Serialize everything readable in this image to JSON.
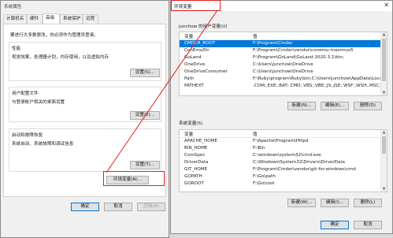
{
  "left_dialog": {
    "title": "系统属性",
    "tabs": [
      {
        "label": "计算机名"
      },
      {
        "label": "硬件"
      },
      {
        "label": "高级"
      },
      {
        "label": "系统保护"
      },
      {
        "label": "远程"
      }
    ],
    "admin_note": "要进行大多数更改，你必须作为管理员登录。",
    "performance": {
      "heading": "性能",
      "desc": "视觉效果，处理器计划，内存使用，以及虚拟内存",
      "button": "设置(S)..."
    },
    "profiles": {
      "heading": "用户配置文件",
      "desc": "与登录帐户相关的桌面设置",
      "button": "设置(E)..."
    },
    "startup": {
      "heading": "启动和故障恢复",
      "desc": "系统启动、系统故障和调试信息",
      "button": "设置(T)..."
    },
    "env_button": "环境变量(N)...",
    "ok": "确定",
    "cancel": "取消",
    "apply": "应用(A)"
  },
  "env_dialog": {
    "title": "环境变量",
    "close_glyph": "✕",
    "user_section_label": "junchow 的用户变量(U)",
    "columns": {
      "var": "变量",
      "val": "值"
    },
    "user_vars": [
      {
        "name": "CMDER_ROOT",
        "value": "F:\\Program\\Cmder",
        "selected": true
      },
      {
        "name": "ConEmuDir",
        "value": "F:\\Program\\Cmder\\vendor\\conemu-maximus5",
        "selected": false
      },
      {
        "name": "GoLand",
        "value": "F:\\Program\\GoLand\\GoLand 2020.3.1\\bin;",
        "selected": false
      },
      {
        "name": "OneDrive",
        "value": "C:\\Users\\junchow\\OneDrive",
        "selected": false
      },
      {
        "name": "OneDriveConsumer",
        "value": "C:\\Users\\junchow\\OneDrive",
        "selected": false
      },
      {
        "name": "Path",
        "value": "F:\\Ruby\\program\\Ruby\\bin;C:\\Users\\junchow\\AppData\\Local\\...",
        "selected": false
      },
      {
        "name": "PATHEXT",
        "value": ".COM;.EXE;.BAT;.CMD;.VBS;.VBE;.JS;.JSE;.WSF;.WSH;.MSC;.RB;...",
        "selected": false
      }
    ],
    "user_buttons": {
      "new": "新建(N)...",
      "edit": "编辑(E)...",
      "delete": "删除(D)"
    },
    "system_section_label": "系统变量(S)",
    "system_vars": [
      {
        "name": "APACHE_HOME",
        "value": "F:\\Apache\\Program\\Httpd"
      },
      {
        "name": "BIN_HOME",
        "value": "F:\\Bin"
      },
      {
        "name": "ComSpec",
        "value": "C:\\windows\\system32\\cmd.exe"
      },
      {
        "name": "DriverData",
        "value": "C:\\Windows\\System32\\Drivers\\DriverData"
      },
      {
        "name": "GIT_HOME",
        "value": "F:\\Program\\Cmder\\vendor\\git-for-windows\\cmd"
      },
      {
        "name": "GOPATH",
        "value": "F:\\Go\\path"
      },
      {
        "name": "GOROOT",
        "value": "F:\\Go\\root"
      }
    ],
    "system_buttons": {
      "new": "新建(W)...",
      "edit": "编辑(I)...",
      "delete": "删除(L)"
    },
    "ok": "确定",
    "cancel": "取消"
  },
  "colors": {
    "accent": "#0078d7",
    "highlight_box": "#e02020"
  }
}
